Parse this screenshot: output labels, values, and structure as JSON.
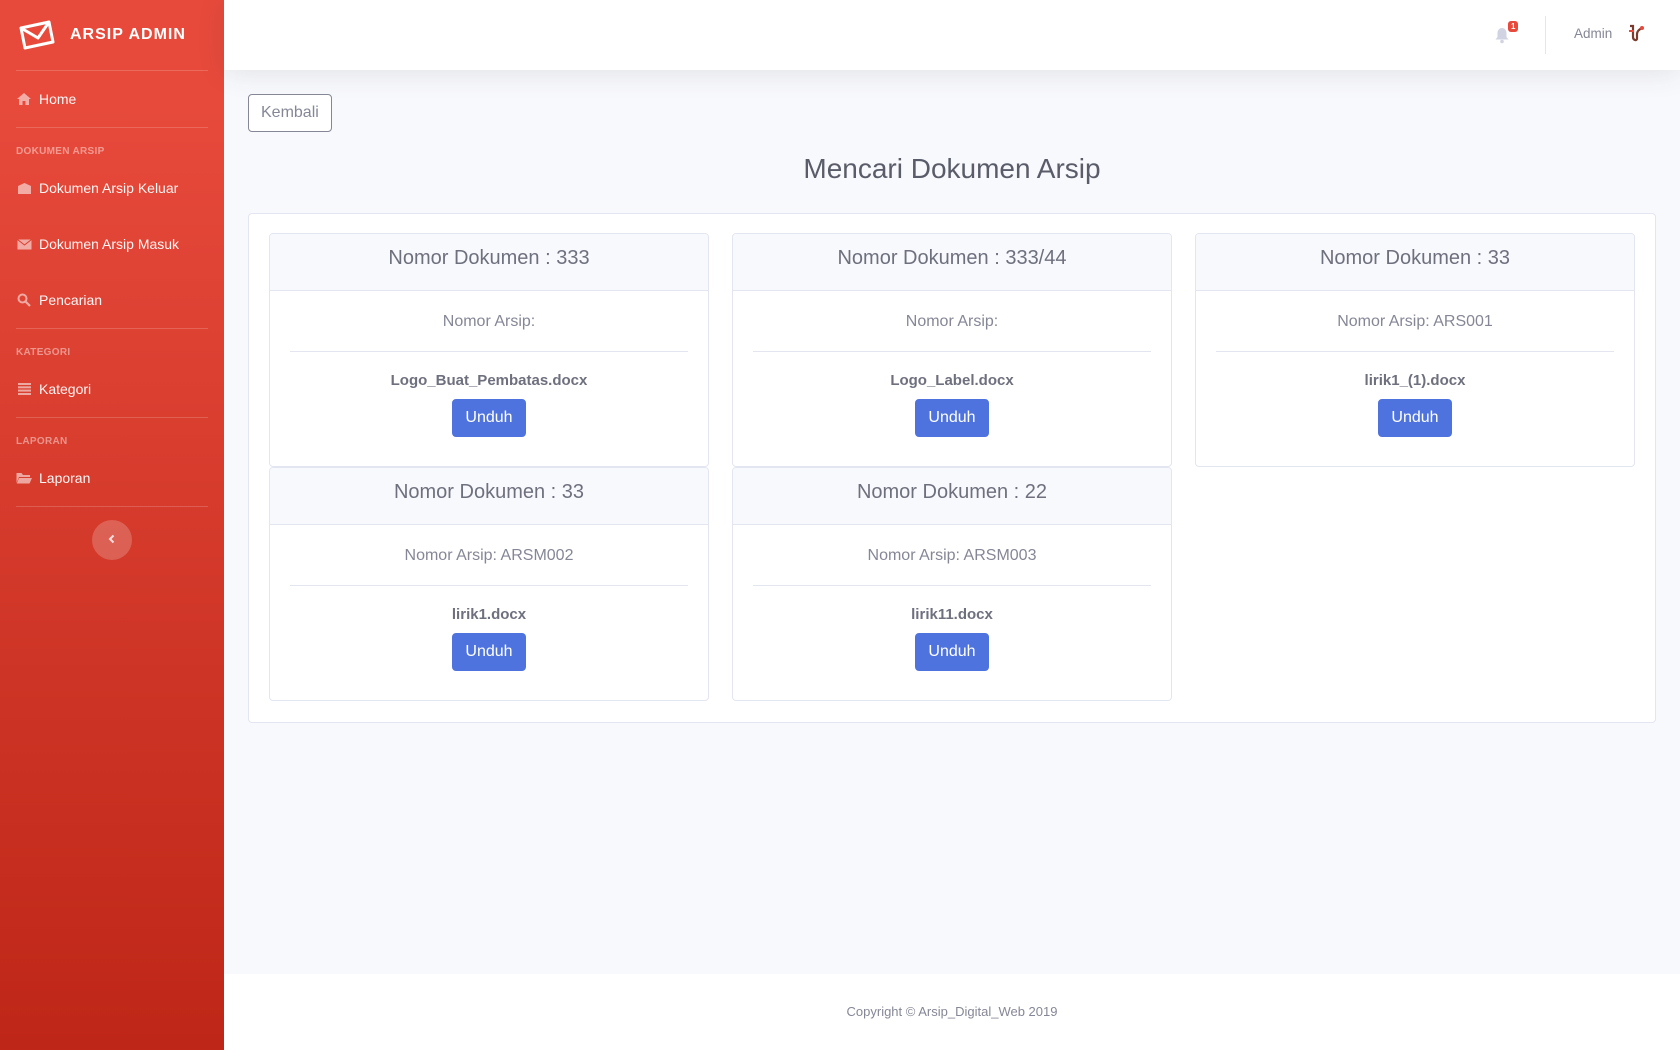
{
  "brand": {
    "title": "ARSIP ADMIN",
    "icon": "envelope-icon"
  },
  "sidebar": {
    "home": {
      "label": "Home",
      "icon": "home-icon"
    },
    "section_dokumen": "DOKUMEN ARSIP",
    "keluar": {
      "label": "Dokumen Arsip Keluar",
      "icon": "box-icon"
    },
    "masuk": {
      "label": "Dokumen Arsip Masuk",
      "icon": "envelope-icon"
    },
    "pencarian": {
      "label": "Pencarian",
      "icon": "search-icon"
    },
    "section_kategori": "KATEGORI",
    "kategori": {
      "label": "Kategori",
      "icon": "list-icon"
    },
    "section_laporan": "LAPORAN",
    "laporan": {
      "label": "Laporan",
      "icon": "folder-icon"
    },
    "toggle_icon": "chevron-left-icon"
  },
  "topbar": {
    "notification_count": "1",
    "user_name": "Admin"
  },
  "main": {
    "back_label": "Kembali",
    "title": "Mencari Dokumen Arsip",
    "unduh_label": "Unduh",
    "documents": [
      {
        "nomor_dokumen": "Nomor Dokumen : 333",
        "nomor_arsip": "Nomor Arsip:",
        "file": "Logo_Buat_Pembatas.docx"
      },
      {
        "nomor_dokumen": "Nomor Dokumen : 333/44",
        "nomor_arsip": "Nomor Arsip:",
        "file": "Logo_Label.docx"
      },
      {
        "nomor_dokumen": "Nomor Dokumen : 33",
        "nomor_arsip": "Nomor Arsip: ARS001",
        "file": "lirik1_(1).docx"
      },
      {
        "nomor_dokumen": "Nomor Dokumen : 33",
        "nomor_arsip": "Nomor Arsip: ARSM002",
        "file": "lirik1.docx"
      },
      {
        "nomor_dokumen": "Nomor Dokumen : 22",
        "nomor_arsip": "Nomor Arsip: ARSM003",
        "file": "lirik11.docx"
      }
    ]
  },
  "footer": {
    "copyright": "Copyright © Arsip_Digital_Web 2019"
  },
  "colors": {
    "sidebar_top": "#e74a3b",
    "sidebar_bottom": "#be2617",
    "primary": "#4e73df",
    "badge": "#e74a3b"
  }
}
